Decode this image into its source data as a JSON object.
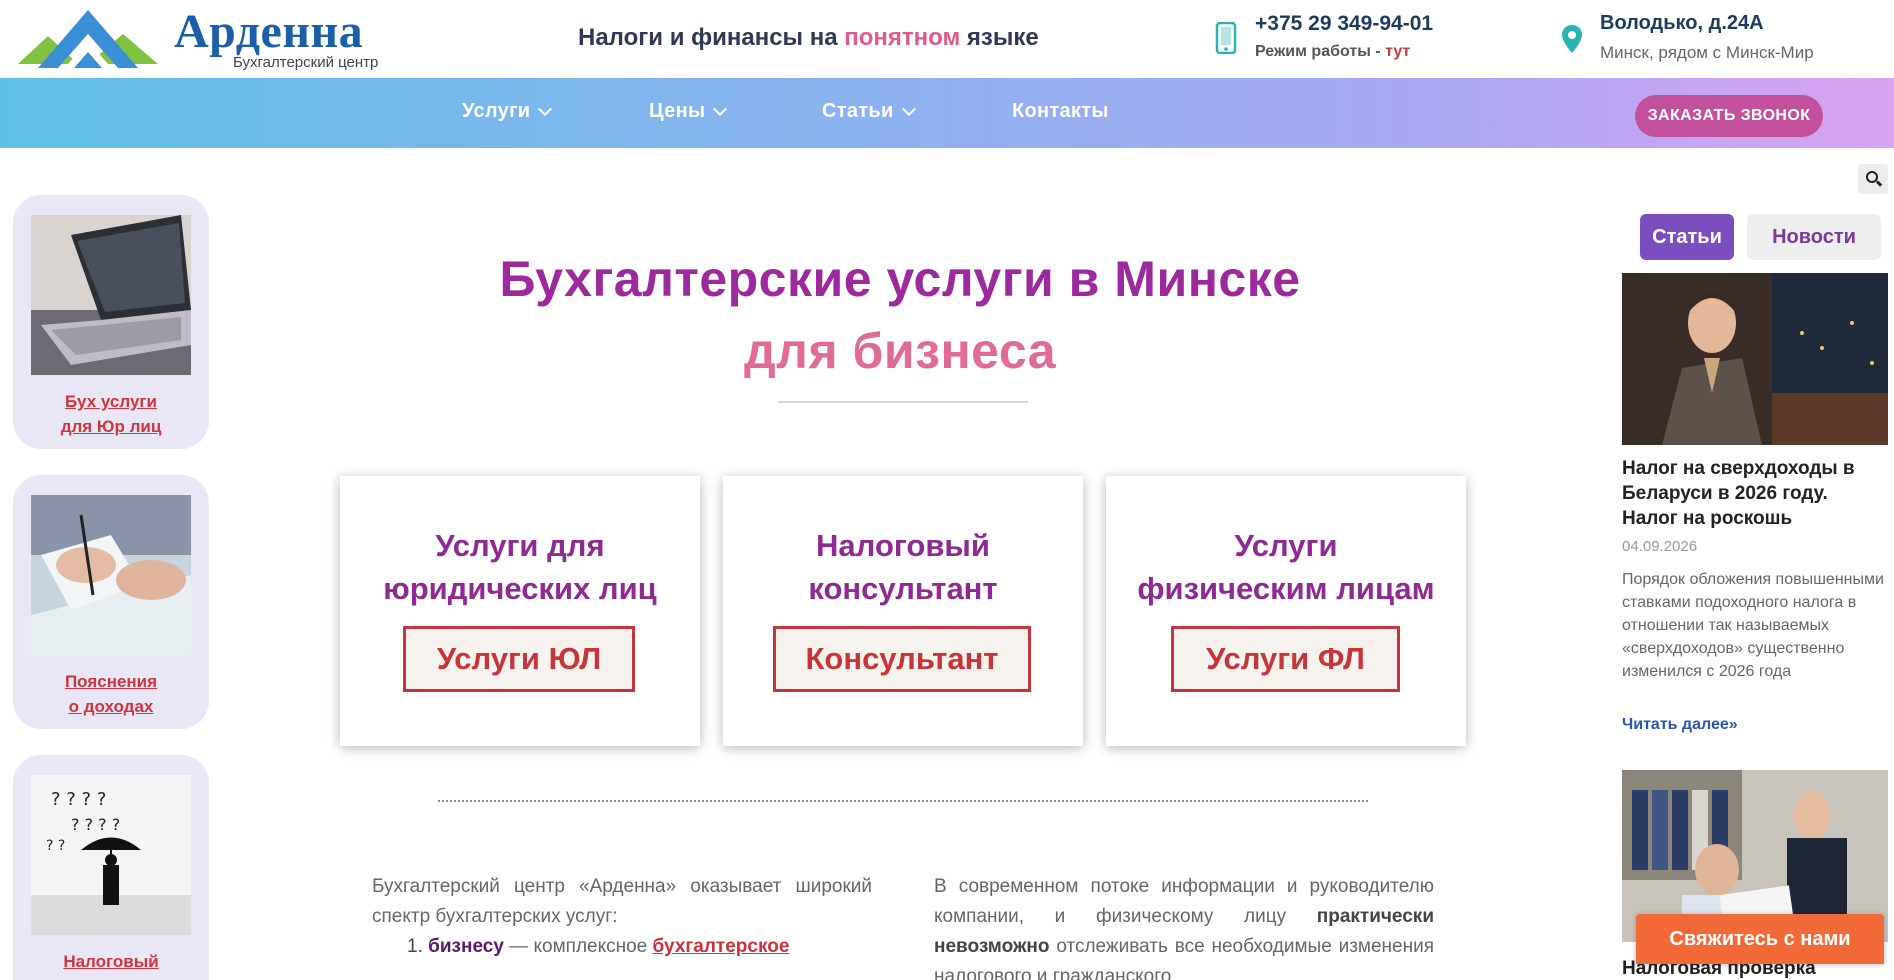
{
  "header": {
    "logo_name": "Арденна",
    "logo_sub": "Бухгалтерский центр",
    "tagline_pre": "Налоги и финансы на ",
    "tagline_accent": "понятном",
    "tagline_post": " языке",
    "phone": "+375 29 349-94-01",
    "hours_label": "Режим работы - ",
    "hours_link": "тут",
    "address": "Володько, д.24А",
    "address_sub": "Минск, рядом с Минск-Мир"
  },
  "nav": {
    "items": [
      {
        "label": "Услуги",
        "icon": "chevron-down-icon"
      },
      {
        "label": "Цены",
        "icon": "chevron-down-icon"
      },
      {
        "label": "Статьи",
        "icon": "chevron-down-icon"
      },
      {
        "label": "Контакты"
      }
    ],
    "call_button": "ЗАКАЗАТЬ ЗВОНОК"
  },
  "left_sidebar": {
    "cards": [
      {
        "line1": "Бух услуги",
        "line2": "для Юр лиц",
        "image": "laptop"
      },
      {
        "line1": "Пояснения",
        "line2": "о доходах",
        "image": "hand-writing"
      },
      {
        "line1": "Налоговый",
        "line2": "",
        "image": "umbrella-questions"
      }
    ]
  },
  "main": {
    "title_line1": "Бухгалтерские услуги в Минске",
    "title_line2": "для бизнеса",
    "services": [
      {
        "title_line1": "Услуги для",
        "title_line2": "юридических лиц",
        "button": "Услуги ЮЛ"
      },
      {
        "title_line1": "Налоговый",
        "title_line2": "консультант",
        "button": "Консультант"
      },
      {
        "title_line1": "Услуги",
        "title_line2": "физическим лицам",
        "button": "Услуги ФЛ"
      }
    ],
    "left_text": "Бухгалтерский центр «Арденна» оказывает широкий спектр бухгалтерских услуг:",
    "list_num": "1.",
    "list_bold": "бизнесу",
    "list_dash": "— комплексное",
    "list_link": "бухгалтерское",
    "right_text_1": "В современном потоке информации и руководителю компании, и физическому лицу ",
    "right_bold": "практически невозможно",
    "right_text_2": " отслеживать все необходимые изменения налогового и гражданского"
  },
  "right_sidebar": {
    "tabs": [
      "Статьи",
      "Новости"
    ],
    "article1": {
      "title": "Налог на сверхдоходы в Беларуси в 2026 году. Налог на роскошь",
      "date": "04.09.2026",
      "excerpt": "Порядок обложения повышенными ставками подоходного налога в отношении так называемых «сверхдоходов» существенно изменился с 2026 года",
      "more": "Читать далее»"
    },
    "article2": {
      "title": "Налоговая проверка"
    },
    "contact_button": "Свяжитесь с нами"
  },
  "colors": {
    "brand_blue": "#1a5fa8",
    "title_purple": "#9c2a9c",
    "title_pink": "#e06b96",
    "accent_red": "#c9333a",
    "call_button": "#c2509a",
    "contact_button": "#f26a38",
    "tab_active": "#7b4dbe"
  }
}
